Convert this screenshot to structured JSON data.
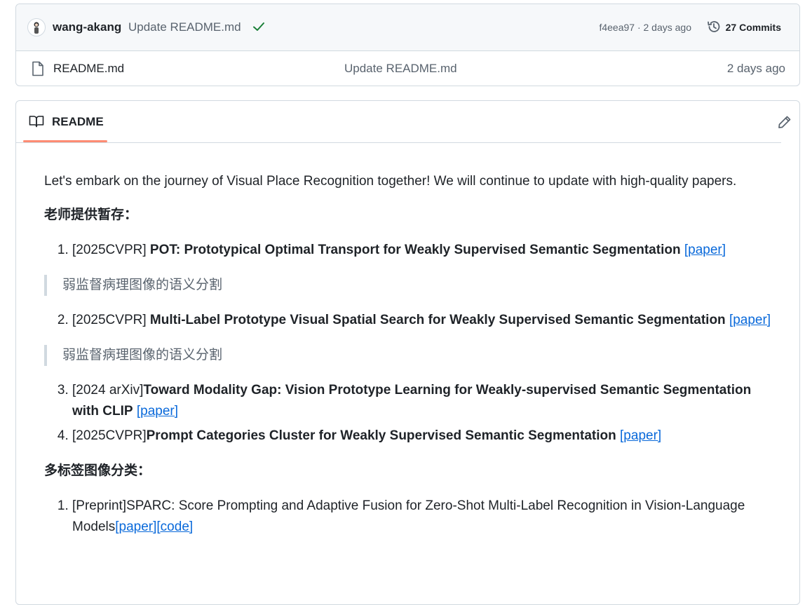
{
  "commit": {
    "author": "wang-akang",
    "message": "Update README.md",
    "hash_time": "f4eea97 · 2 days ago",
    "commits_label": "27 Commits"
  },
  "file": {
    "name": "README.md",
    "message": "Update README.md",
    "time": "2 days ago"
  },
  "readme": {
    "title": "README",
    "intro": "Let's embark on the journey of Visual Place Recognition together! We will continue to update with high-quality papers.",
    "section1": {
      "heading": "老师提供暂存：",
      "items": [
        {
          "prefix": "[2025CVPR] ",
          "title": "POT: Prototypical Optimal Transport for Weakly Supervised Semantic Segmentation",
          "link": "[paper]",
          "note": "弱监督病理图像的语义分割"
        },
        {
          "prefix": "[2025CVPR] ",
          "title": "Multi-Label Prototype Visual Spatial Search for Weakly Supervised Semantic Segmentation",
          "link": "[paper]",
          "note": "弱监督病理图像的语义分割"
        },
        {
          "prefix": "[2024 arXiv]",
          "title": "Toward Modality Gap: Vision Prototype Learning for Weakly-supervised Semantic Segmentation with CLIP",
          "link": "[paper]"
        },
        {
          "prefix": "[2025CVPR]",
          "title": "Prompt Categories Cluster for Weakly Supervised Semantic Segmentation",
          "link": "[paper]"
        }
      ]
    },
    "section2": {
      "heading": "多标签图像分类：",
      "items": [
        {
          "text": "[Preprint]SPARC: Score Prompting and Adaptive Fusion for Zero-Shot Multi-Label Recognition in Vision-Language Models",
          "link1": "[paper]",
          "link2": "[code]"
        }
      ]
    }
  },
  "colors": {
    "accent": "#0969da",
    "check": "#1a7f37",
    "tab_underline": "#fd8c73"
  }
}
